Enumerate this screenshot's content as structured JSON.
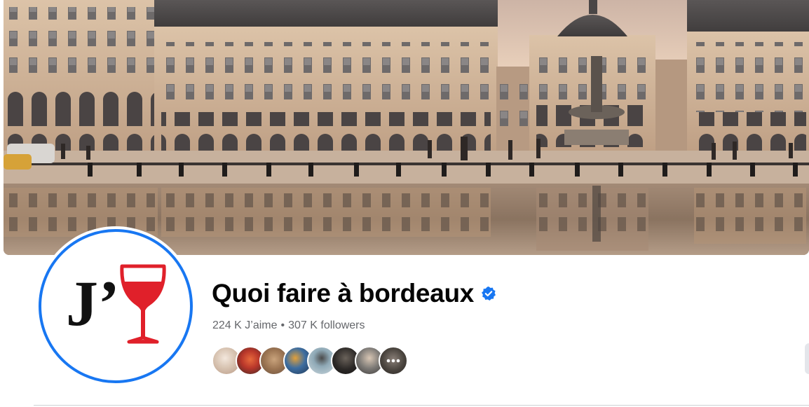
{
  "page": {
    "name": "Quoi faire à bordeaux",
    "verified_icon": "verified-badge-icon",
    "likes": "224 K J’aime",
    "separator": "•",
    "followers": "307 K followers"
  },
  "profile_picture": {
    "logo_text": "J’",
    "logo_icon": "wine-glass-icon",
    "ring_color": "#1877f2",
    "wine_color": "#e0202a"
  },
  "follower_avatars": [
    {
      "name": "follower-avatar",
      "color": "#e7d8cc"
    },
    {
      "name": "follower-avatar",
      "color": "#c0442e"
    },
    {
      "name": "follower-avatar",
      "color": "#a98561"
    },
    {
      "name": "follower-avatar",
      "color": "#2f5b8a"
    },
    {
      "name": "follower-avatar",
      "color": "#8fa7b2"
    },
    {
      "name": "follower-avatar",
      "color": "#2a2826"
    },
    {
      "name": "follower-avatar",
      "color": "#7b7b78"
    },
    {
      "name": "follower-avatar",
      "color": "#3e3a36"
    }
  ],
  "colors": {
    "text_primary": "#050505",
    "text_secondary": "#65676b",
    "accent": "#1877f2"
  }
}
